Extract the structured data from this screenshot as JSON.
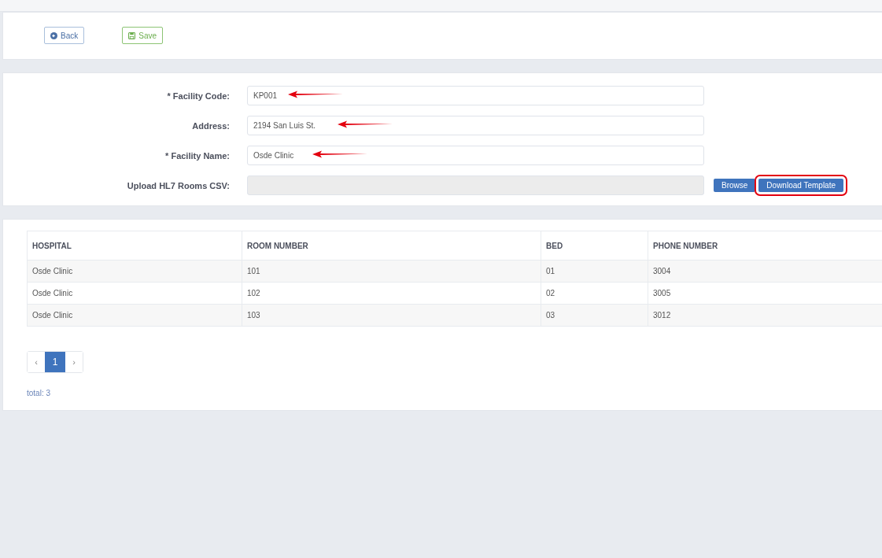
{
  "toolbar": {
    "buttons": [
      {
        "kind": "back",
        "label": "Back"
      },
      {
        "kind": "save",
        "label": "Save"
      }
    ]
  },
  "form": {
    "fields": [
      {
        "label": "* Facility Code:",
        "kind": "text",
        "value": "KP001",
        "arrow": true
      },
      {
        "label": "Address:",
        "kind": "text",
        "value": "2194 San Luis St.",
        "arrow": true
      },
      {
        "label": "* Facility Name:",
        "kind": "text",
        "value": "Osde Clinic",
        "arrow": true
      },
      {
        "label": "Upload HL7 Rooms CSV:",
        "kind": "file",
        "buttons": [
          {
            "label": "Browse",
            "highlighted": false
          },
          {
            "label": "Download Template",
            "highlighted": true
          }
        ]
      }
    ]
  },
  "table": {
    "columns": [
      "HOSPITAL",
      "ROOM NUMBER",
      "BED",
      "PHONE NUMBER"
    ],
    "rows": [
      [
        "Osde Clinic",
        "101",
        "01",
        "3004"
      ],
      [
        "Osde Clinic",
        "102",
        "02",
        "3005"
      ],
      [
        "Osde Clinic",
        "103",
        "03",
        "3012"
      ]
    ]
  },
  "pagination": {
    "prev": "‹",
    "pages": [
      {
        "label": "1",
        "selected": true
      }
    ],
    "next": "›"
  },
  "total": "total: 3"
}
